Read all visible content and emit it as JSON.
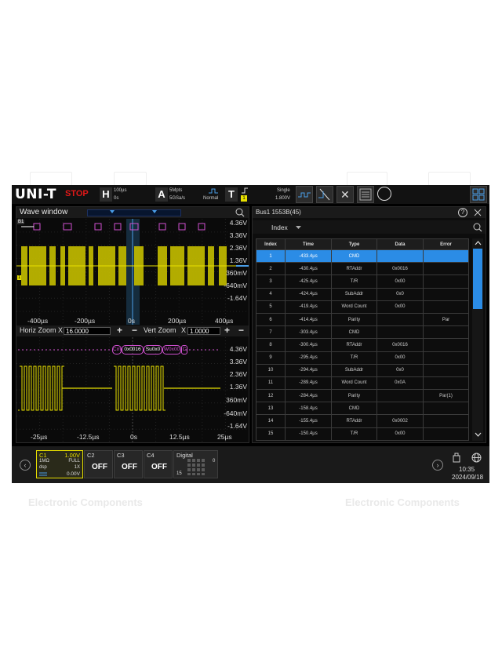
{
  "app": {
    "logo": "UNI-T",
    "status": "STOP"
  },
  "topbar": {
    "horiz": {
      "letter": "H",
      "scale": "100µs",
      "offset": "0s"
    },
    "acq": {
      "letter": "A",
      "depth": "5Mpts",
      "rate": "5GSa/s",
      "mode": "Normal"
    },
    "trigger": {
      "letter": "T",
      "mode": "Single",
      "level": "1.800V",
      "source": "1"
    }
  },
  "wave_window": {
    "title": "Wave window",
    "bus_label": "B1",
    "ch_label": "1",
    "volts_top": [
      "4.36V",
      "3.36V",
      "2.36V",
      "1.36V",
      "360mV",
      "-640mV",
      "-1.64V"
    ],
    "x_ticks_top": [
      "-400µs",
      "-200µs",
      "0s",
      "200µs",
      "400µs"
    ],
    "zoom": {
      "horiz_label": "Horiz Zoom",
      "horiz_x": "X",
      "horiz_value": "16.0000",
      "vert_label": "Vert Zoom",
      "vert_x": "X",
      "vert_value": "1.0000",
      "plus": "+",
      "minus": "−"
    },
    "decode_labels": [
      "Cm",
      "0x0016",
      "Su0x0",
      "W0x00",
      "C"
    ],
    "volts_bottom": [
      "4.36V",
      "3.36V",
      "2.36V",
      "1.36V",
      "360mV",
      "-640mV",
      "-1.64V"
    ],
    "x_ticks_bottom": [
      "-25µs",
      "-12.5µs",
      "0s",
      "12.5µs",
      "25µs"
    ]
  },
  "bus_panel": {
    "title": "Bus1 1553B(45)",
    "sort_field": "Index",
    "columns": [
      "Index",
      "Time",
      "Type",
      "Data",
      "Error"
    ],
    "rows": [
      [
        "1",
        "-433.4µs",
        "CMD",
        "",
        ""
      ],
      [
        "2",
        "-430.4µs",
        "RTAddr",
        "0x0016",
        ""
      ],
      [
        "3",
        "-425.4µs",
        "T/R",
        "0x00",
        ""
      ],
      [
        "4",
        "-424.4µs",
        "SubAddr",
        "0x0",
        ""
      ],
      [
        "5",
        "-419.4µs",
        "Word Count",
        "0x00",
        ""
      ],
      [
        "6",
        "-414.4µs",
        "Parity",
        "",
        "Par"
      ],
      [
        "7",
        "-303.4µs",
        "CMD",
        "",
        ""
      ],
      [
        "8",
        "-300.4µs",
        "RTAddr",
        "0x0016",
        ""
      ],
      [
        "9",
        "-295.4µs",
        "T/R",
        "0x00",
        ""
      ],
      [
        "10",
        "-294.4µs",
        "SubAddr",
        "0x0",
        ""
      ],
      [
        "11",
        "-289.4µs",
        "Word Count",
        "0x0A",
        ""
      ],
      [
        "12",
        "-284.4µs",
        "Parity",
        "",
        "Par(1)"
      ],
      [
        "13",
        "-158.4µs",
        "CMD",
        "",
        ""
      ],
      [
        "14",
        "-155.4µs",
        "RTAddr",
        "0x0002",
        ""
      ],
      [
        "15",
        "-150.4µs",
        "T/R",
        "0x00",
        ""
      ]
    ],
    "selected_row": 0
  },
  "channels": {
    "c1": {
      "name": "C1",
      "scale": "1.00V",
      "impedance": "1MΩ",
      "bw": "FULL",
      "coupling": "dsp",
      "probe": "1X",
      "offset": "0.00V"
    },
    "c2": {
      "name": "C2",
      "state": "OFF"
    },
    "c3": {
      "name": "C3",
      "state": "OFF"
    },
    "c4": {
      "name": "C4",
      "state": "OFF"
    },
    "digital": {
      "name": "Digital",
      "low": "0",
      "high": "15"
    }
  },
  "clock": {
    "time": "10:35",
    "date": "2024/09/18"
  },
  "watermark": {
    "text": "Electronic Components"
  },
  "colors": {
    "ch1": "#e8e000",
    "bus": "#d050d0",
    "selected": "#2b8ce6",
    "stop": "#e01818"
  }
}
